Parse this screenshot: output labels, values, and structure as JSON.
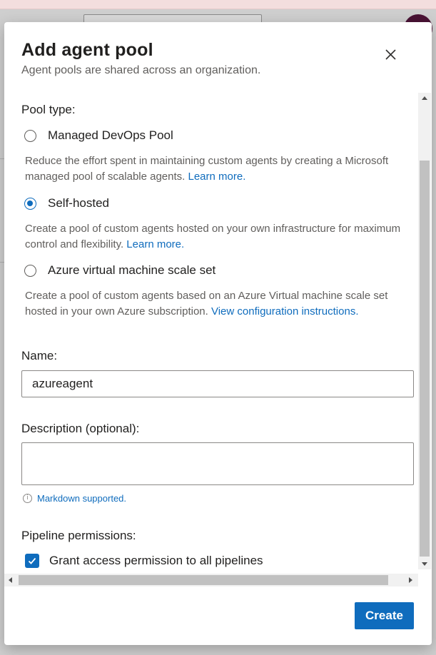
{
  "dialog": {
    "title": "Add agent pool",
    "subtitle": "Agent pools are shared across an organization."
  },
  "pool_type": {
    "label": "Pool type:",
    "options": [
      {
        "label": "Managed DevOps Pool",
        "selected": false,
        "description": "Reduce the effort spent in maintaining custom agents by creating a Microsoft managed pool of scalable agents.",
        "link": "Learn more."
      },
      {
        "label": "Self-hosted",
        "selected": true,
        "description": "Create a pool of custom agents hosted on your own infrastructure for maximum control and flexibility.",
        "link": "Learn more."
      },
      {
        "label": "Azure virtual machine scale set",
        "selected": false,
        "description": "Create a pool of custom agents based on an Azure Virtual machine scale set hosted in your own Azure subscription.",
        "link": "View configuration instructions."
      }
    ]
  },
  "name_field": {
    "label": "Name:",
    "value": "azureagent"
  },
  "description_field": {
    "label": "Description (optional):",
    "value": "",
    "note": "Markdown supported."
  },
  "pipeline_permissions": {
    "label": "Pipeline permissions:",
    "checkbox_label": "Grant access permission to all pipelines",
    "checked": true
  },
  "footer": {
    "create_label": "Create"
  },
  "colors": {
    "accent": "#0f6cbd",
    "text": "#201f1e",
    "secondary_text": "#605e5c"
  }
}
